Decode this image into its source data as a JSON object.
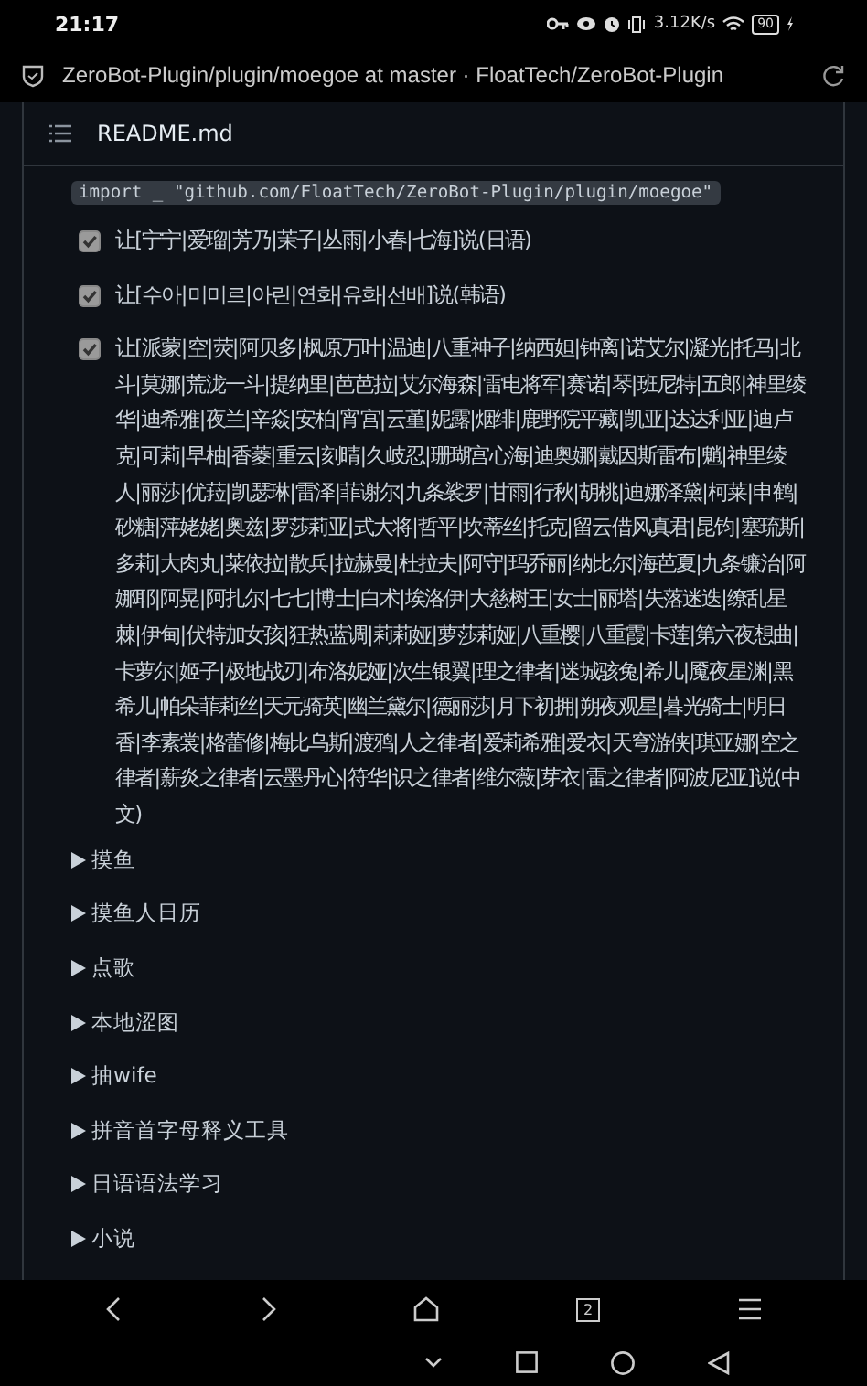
{
  "status_bar": {
    "time": "21:17",
    "net_speed": "3.12K/s",
    "battery": "90"
  },
  "address_bar": {
    "title": "ZeroBot-Plugin/plugin/moegoe at master · FloatTech/ZeroBot-Plugin"
  },
  "file_header": {
    "name": "README.md"
  },
  "code_line": "import _ \"github.com/FloatTech/ZeroBot-Plugin/plugin/moegoe\"",
  "tasks": [
    {
      "text": "让[宁宁|爱瑠|芳乃|茉子|丛雨|小春|七海]说(日语)",
      "checked": true
    },
    {
      "text": "让[수아|미미르|아린|연화|유화|선배]说(韩语)",
      "checked": true
    },
    {
      "text": "让[派蒙|空|荧|阿贝多|枫原万叶|温迪|八重神子|纳西妲|钟离|诺艾尔|凝光|托马|北斗|莫娜|荒泷一斗|提纳里|芭芭拉|艾尔海森|雷电将军|赛诺|琴|班尼特|五郎|神里绫华|迪希雅|夜兰|辛焱|安柏|宵宫|云堇|妮露|烟绯|鹿野院平藏|凯亚|达达利亚|迪卢克|可莉|早柚|香菱|重云|刻晴|久岐忍|珊瑚宫心海|迪奥娜|戴因斯雷布|魈|神里绫人|丽莎|优菈|凯瑟琳|雷泽|菲谢尔|九条裟罗|甘雨|行秋|胡桃|迪娜泽黛|柯莱|申鹤|砂糖|萍姥姥|奥兹|罗莎莉亚|式大将|哲平|坎蒂丝|托克|留云借风真君|昆钧|塞琉斯|多莉|大肉丸|莱依拉|散兵|拉赫曼|杜拉夫|阿守|玛乔丽|纳比尔|海芭夏|九条镰治|阿娜耶|阿晃|阿扎尔|七七|博士|白术|埃洛伊|大慈树王|女士|丽塔|失落迷迭|缭乱星棘|伊甸|伏特加女孩|狂热蓝调|莉莉娅|萝莎莉娅|八重樱|八重霞|卡莲|第六夜想曲|卡萝尔|姬子|极地战刃|布洛妮娅|次生银翼|理之律者|迷城骇兔|希儿|魇夜星渊|黑希儿|帕朵菲莉丝|天元骑英|幽兰黛尔|德丽莎|月下初拥|朔夜观星|暮光骑士|明日香|李素裳|格蕾修|梅比乌斯|渡鸦|人之律者|爱莉希雅|爱衣|天穹游侠|琪亚娜|空之律者|薪炎之律者|云墨丹心|符华|识之律者|维尔薇|芽衣|雷之律者|阿波尼亚]说(中文)",
      "checked": true
    }
  ],
  "sections": [
    {
      "label": "摸鱼",
      "expanded": false
    },
    {
      "label": "摸鱼人日历",
      "expanded": false
    },
    {
      "label": "点歌",
      "expanded": false
    },
    {
      "label": "本地涩图",
      "expanded": false
    },
    {
      "label": "抽wife",
      "expanded": false
    },
    {
      "label": "拼音首字母释义工具",
      "expanded": false
    },
    {
      "label": "日语语法学习",
      "expanded": false
    },
    {
      "label": "小说",
      "expanded": false
    }
  ],
  "nav_bar": {
    "tab_count": "2"
  }
}
